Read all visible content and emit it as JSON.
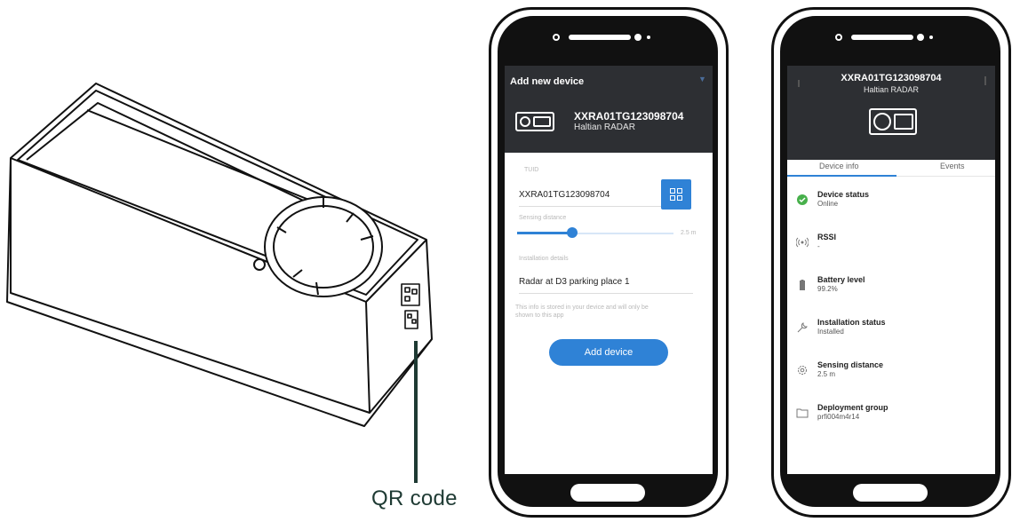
{
  "callout": {
    "label": "QR code"
  },
  "add_device": {
    "header_title": "Add new device",
    "device_name": "XXRA01TG123098704",
    "device_type": "Haltian RADAR",
    "tuid_label": "TUID",
    "tuid_value": "XXRA01TG123098704",
    "sensing_label": "Sensing distance",
    "sensing_value": "2.5 m",
    "sensing_fraction": 0.35,
    "install_label": "Installation details",
    "install_value": "Radar at D3 parking place 1",
    "helper": "This info is stored in your device and will only be shown to this app",
    "button": "Add device"
  },
  "device_info": {
    "device_name": "XXRA01TG123098704",
    "device_type": "Haltian RADAR",
    "tabs": [
      "Device info",
      "Events"
    ],
    "rows": [
      {
        "title": "Device status",
        "value": "Online",
        "icon": "check-circle-icon"
      },
      {
        "title": "RSSI",
        "value": "-",
        "icon": "signal-icon"
      },
      {
        "title": "Battery level",
        "value": "99.2%",
        "icon": "battery-icon"
      },
      {
        "title": "Installation status",
        "value": "Installed",
        "icon": "wrench-icon"
      },
      {
        "title": "Sensing distance",
        "value": "2.5 m",
        "icon": "gear-icon"
      },
      {
        "title": "Deployment group",
        "value": "prfi004m4r14",
        "icon": "folder-icon"
      }
    ]
  },
  "colors": {
    "accent": "#2f82d6",
    "header": "#2d2f33",
    "online": "#47b04b",
    "callout": "#1e3a33"
  }
}
